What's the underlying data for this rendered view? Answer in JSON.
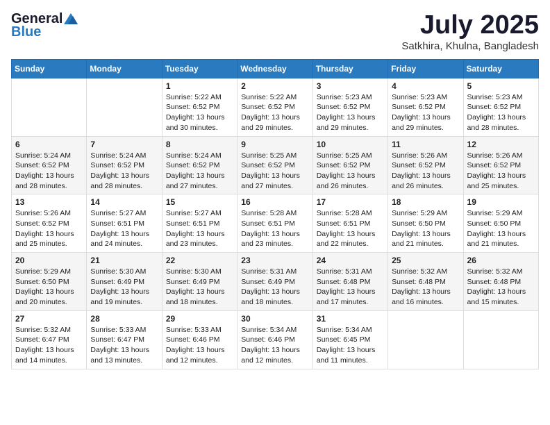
{
  "logo": {
    "general": "General",
    "blue": "Blue"
  },
  "title": "July 2025",
  "location": "Satkhira, Khulna, Bangladesh",
  "days_of_week": [
    "Sunday",
    "Monday",
    "Tuesday",
    "Wednesday",
    "Thursday",
    "Friday",
    "Saturday"
  ],
  "weeks": [
    [
      {
        "day": "",
        "info": ""
      },
      {
        "day": "",
        "info": ""
      },
      {
        "day": "1",
        "info": "Sunrise: 5:22 AM\nSunset: 6:52 PM\nDaylight: 13 hours and 30 minutes."
      },
      {
        "day": "2",
        "info": "Sunrise: 5:22 AM\nSunset: 6:52 PM\nDaylight: 13 hours and 29 minutes."
      },
      {
        "day": "3",
        "info": "Sunrise: 5:23 AM\nSunset: 6:52 PM\nDaylight: 13 hours and 29 minutes."
      },
      {
        "day": "4",
        "info": "Sunrise: 5:23 AM\nSunset: 6:52 PM\nDaylight: 13 hours and 29 minutes."
      },
      {
        "day": "5",
        "info": "Sunrise: 5:23 AM\nSunset: 6:52 PM\nDaylight: 13 hours and 28 minutes."
      }
    ],
    [
      {
        "day": "6",
        "info": "Sunrise: 5:24 AM\nSunset: 6:52 PM\nDaylight: 13 hours and 28 minutes."
      },
      {
        "day": "7",
        "info": "Sunrise: 5:24 AM\nSunset: 6:52 PM\nDaylight: 13 hours and 28 minutes."
      },
      {
        "day": "8",
        "info": "Sunrise: 5:24 AM\nSunset: 6:52 PM\nDaylight: 13 hours and 27 minutes."
      },
      {
        "day": "9",
        "info": "Sunrise: 5:25 AM\nSunset: 6:52 PM\nDaylight: 13 hours and 27 minutes."
      },
      {
        "day": "10",
        "info": "Sunrise: 5:25 AM\nSunset: 6:52 PM\nDaylight: 13 hours and 26 minutes."
      },
      {
        "day": "11",
        "info": "Sunrise: 5:26 AM\nSunset: 6:52 PM\nDaylight: 13 hours and 26 minutes."
      },
      {
        "day": "12",
        "info": "Sunrise: 5:26 AM\nSunset: 6:52 PM\nDaylight: 13 hours and 25 minutes."
      }
    ],
    [
      {
        "day": "13",
        "info": "Sunrise: 5:26 AM\nSunset: 6:52 PM\nDaylight: 13 hours and 25 minutes."
      },
      {
        "day": "14",
        "info": "Sunrise: 5:27 AM\nSunset: 6:51 PM\nDaylight: 13 hours and 24 minutes."
      },
      {
        "day": "15",
        "info": "Sunrise: 5:27 AM\nSunset: 6:51 PM\nDaylight: 13 hours and 23 minutes."
      },
      {
        "day": "16",
        "info": "Sunrise: 5:28 AM\nSunset: 6:51 PM\nDaylight: 13 hours and 23 minutes."
      },
      {
        "day": "17",
        "info": "Sunrise: 5:28 AM\nSunset: 6:51 PM\nDaylight: 13 hours and 22 minutes."
      },
      {
        "day": "18",
        "info": "Sunrise: 5:29 AM\nSunset: 6:50 PM\nDaylight: 13 hours and 21 minutes."
      },
      {
        "day": "19",
        "info": "Sunrise: 5:29 AM\nSunset: 6:50 PM\nDaylight: 13 hours and 21 minutes."
      }
    ],
    [
      {
        "day": "20",
        "info": "Sunrise: 5:29 AM\nSunset: 6:50 PM\nDaylight: 13 hours and 20 minutes."
      },
      {
        "day": "21",
        "info": "Sunrise: 5:30 AM\nSunset: 6:49 PM\nDaylight: 13 hours and 19 minutes."
      },
      {
        "day": "22",
        "info": "Sunrise: 5:30 AM\nSunset: 6:49 PM\nDaylight: 13 hours and 18 minutes."
      },
      {
        "day": "23",
        "info": "Sunrise: 5:31 AM\nSunset: 6:49 PM\nDaylight: 13 hours and 18 minutes."
      },
      {
        "day": "24",
        "info": "Sunrise: 5:31 AM\nSunset: 6:48 PM\nDaylight: 13 hours and 17 minutes."
      },
      {
        "day": "25",
        "info": "Sunrise: 5:32 AM\nSunset: 6:48 PM\nDaylight: 13 hours and 16 minutes."
      },
      {
        "day": "26",
        "info": "Sunrise: 5:32 AM\nSunset: 6:48 PM\nDaylight: 13 hours and 15 minutes."
      }
    ],
    [
      {
        "day": "27",
        "info": "Sunrise: 5:32 AM\nSunset: 6:47 PM\nDaylight: 13 hours and 14 minutes."
      },
      {
        "day": "28",
        "info": "Sunrise: 5:33 AM\nSunset: 6:47 PM\nDaylight: 13 hours and 13 minutes."
      },
      {
        "day": "29",
        "info": "Sunrise: 5:33 AM\nSunset: 6:46 PM\nDaylight: 13 hours and 12 minutes."
      },
      {
        "day": "30",
        "info": "Sunrise: 5:34 AM\nSunset: 6:46 PM\nDaylight: 13 hours and 12 minutes."
      },
      {
        "day": "31",
        "info": "Sunrise: 5:34 AM\nSunset: 6:45 PM\nDaylight: 13 hours and 11 minutes."
      },
      {
        "day": "",
        "info": ""
      },
      {
        "day": "",
        "info": ""
      }
    ]
  ]
}
